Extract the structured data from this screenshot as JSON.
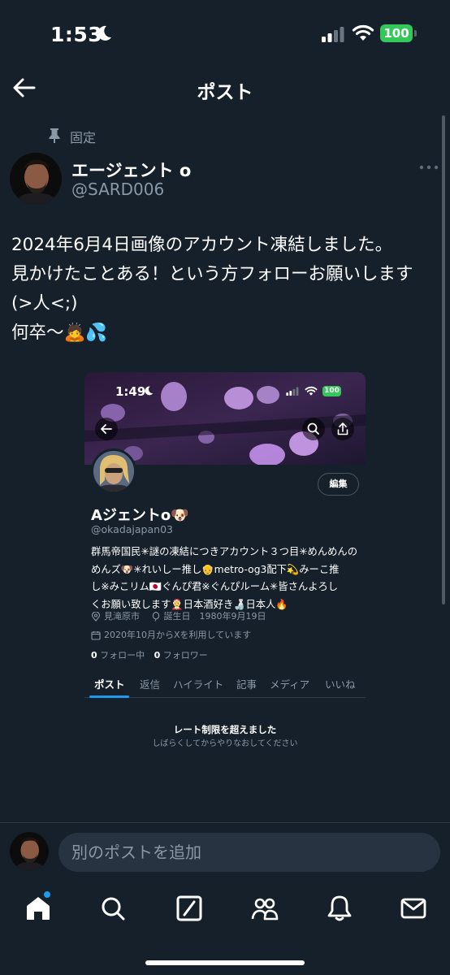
{
  "status_bar": {
    "time": "1:53",
    "battery": "100"
  },
  "header": {
    "title": "ポスト"
  },
  "post": {
    "pinned_label": "固定",
    "author_name": "エージェント o",
    "author_handle": "@SARD006",
    "text_lines": [
      "2024年6月4日画像のアカウント凍結しました。",
      "見かけたことある！という方フォローお願いします",
      "(>人<;)",
      "何卒〜🙇💦"
    ]
  },
  "embedded_profile": {
    "status_time": "1:49",
    "battery": "100",
    "edit_label": "編集",
    "name": "Aジェントo🐶",
    "handle": "@okadajapan03",
    "bio_lines": [
      "群馬帝国民✳︎謎の凍結につきアカウント３つ目✳︎めんめんの",
      "めんズ🐶✳︎れいしー推し👴metro-og3配下💫みーこ推",
      "し※みこリム🇯🇵ぐんぴ君※ぐんぴルーム✳︎皆さんよろし",
      "くお願い致します🤶日本酒好き🍶日本人🔥"
    ],
    "location": "見滝原市",
    "birthday": "誕生日　1980年9月19日",
    "joined": "2020年10月からXを利用しています",
    "following_count": "0",
    "following_label": " フォロー中",
    "followers_count": "0",
    "followers_label": " フォロワー",
    "tabs": [
      "ポスト",
      "返信",
      "ハイライト",
      "記事",
      "メディア",
      "いいね"
    ],
    "rate_limit_title": "レート制限を超えました",
    "rate_limit_sub": "しばらくしてからやりなおしてください"
  },
  "composer": {
    "placeholder": "別のポストを追加"
  },
  "nav": {
    "items": [
      "home-icon",
      "search-icon",
      "grok-icon",
      "communities-icon",
      "notifications-icon",
      "messages-icon"
    ]
  },
  "colors": {
    "background": "#15202b",
    "accent": "#1d9bf0",
    "muted_text": "#8b98a5",
    "battery_green": "#34c759"
  }
}
